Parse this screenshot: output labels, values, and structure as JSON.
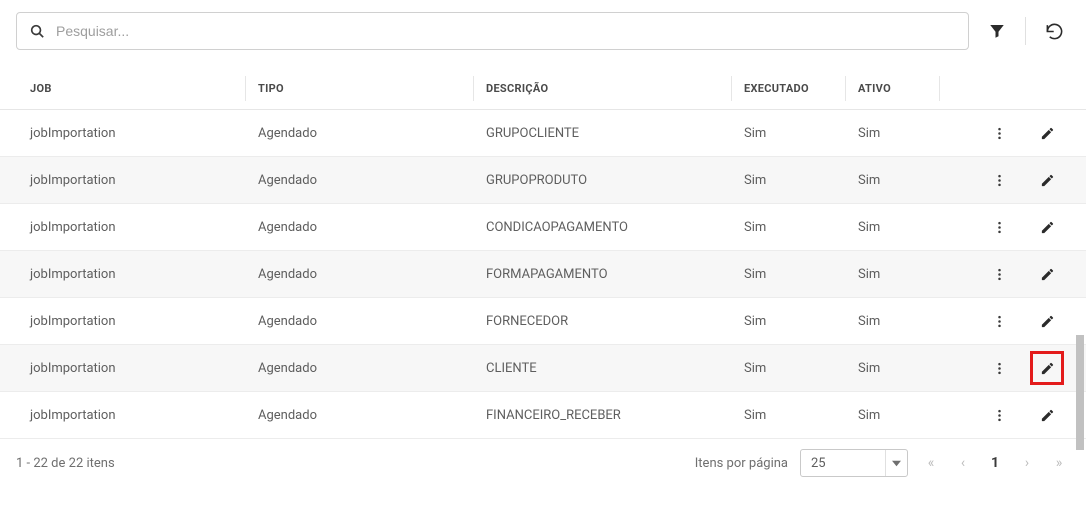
{
  "search": {
    "placeholder": "Pesquisar..."
  },
  "columns": {
    "job": "JOB",
    "tipo": "TIPO",
    "desc": "DESCRIÇÃO",
    "exec": "EXECUTADO",
    "ativo": "ATIVO"
  },
  "rows": [
    {
      "job": "jobImportation",
      "tipo": "Agendado",
      "desc": "GRUPOCLIENTE",
      "exec": "Sim",
      "ativo": "Sim"
    },
    {
      "job": "jobImportation",
      "tipo": "Agendado",
      "desc": "GRUPOPRODUTO",
      "exec": "Sim",
      "ativo": "Sim"
    },
    {
      "job": "jobImportation",
      "tipo": "Agendado",
      "desc": "CONDICAOPAGAMENTO",
      "exec": "Sim",
      "ativo": "Sim"
    },
    {
      "job": "jobImportation",
      "tipo": "Agendado",
      "desc": "FORMAPAGAMENTO",
      "exec": "Sim",
      "ativo": "Sim"
    },
    {
      "job": "jobImportation",
      "tipo": "Agendado",
      "desc": "FORNECEDOR",
      "exec": "Sim",
      "ativo": "Sim"
    },
    {
      "job": "jobImportation",
      "tipo": "Agendado",
      "desc": "CLIENTE",
      "exec": "Sim",
      "ativo": "Sim"
    },
    {
      "job": "jobImportation",
      "tipo": "Agendado",
      "desc": "FINANCEIRO_RECEBER",
      "exec": "Sim",
      "ativo": "Sim"
    }
  ],
  "highlighted_row_index": 5,
  "footer": {
    "summary": "1 - 22 de 22 itens",
    "page_label": "Itens por página",
    "page_size": "25",
    "current_page": "1"
  }
}
